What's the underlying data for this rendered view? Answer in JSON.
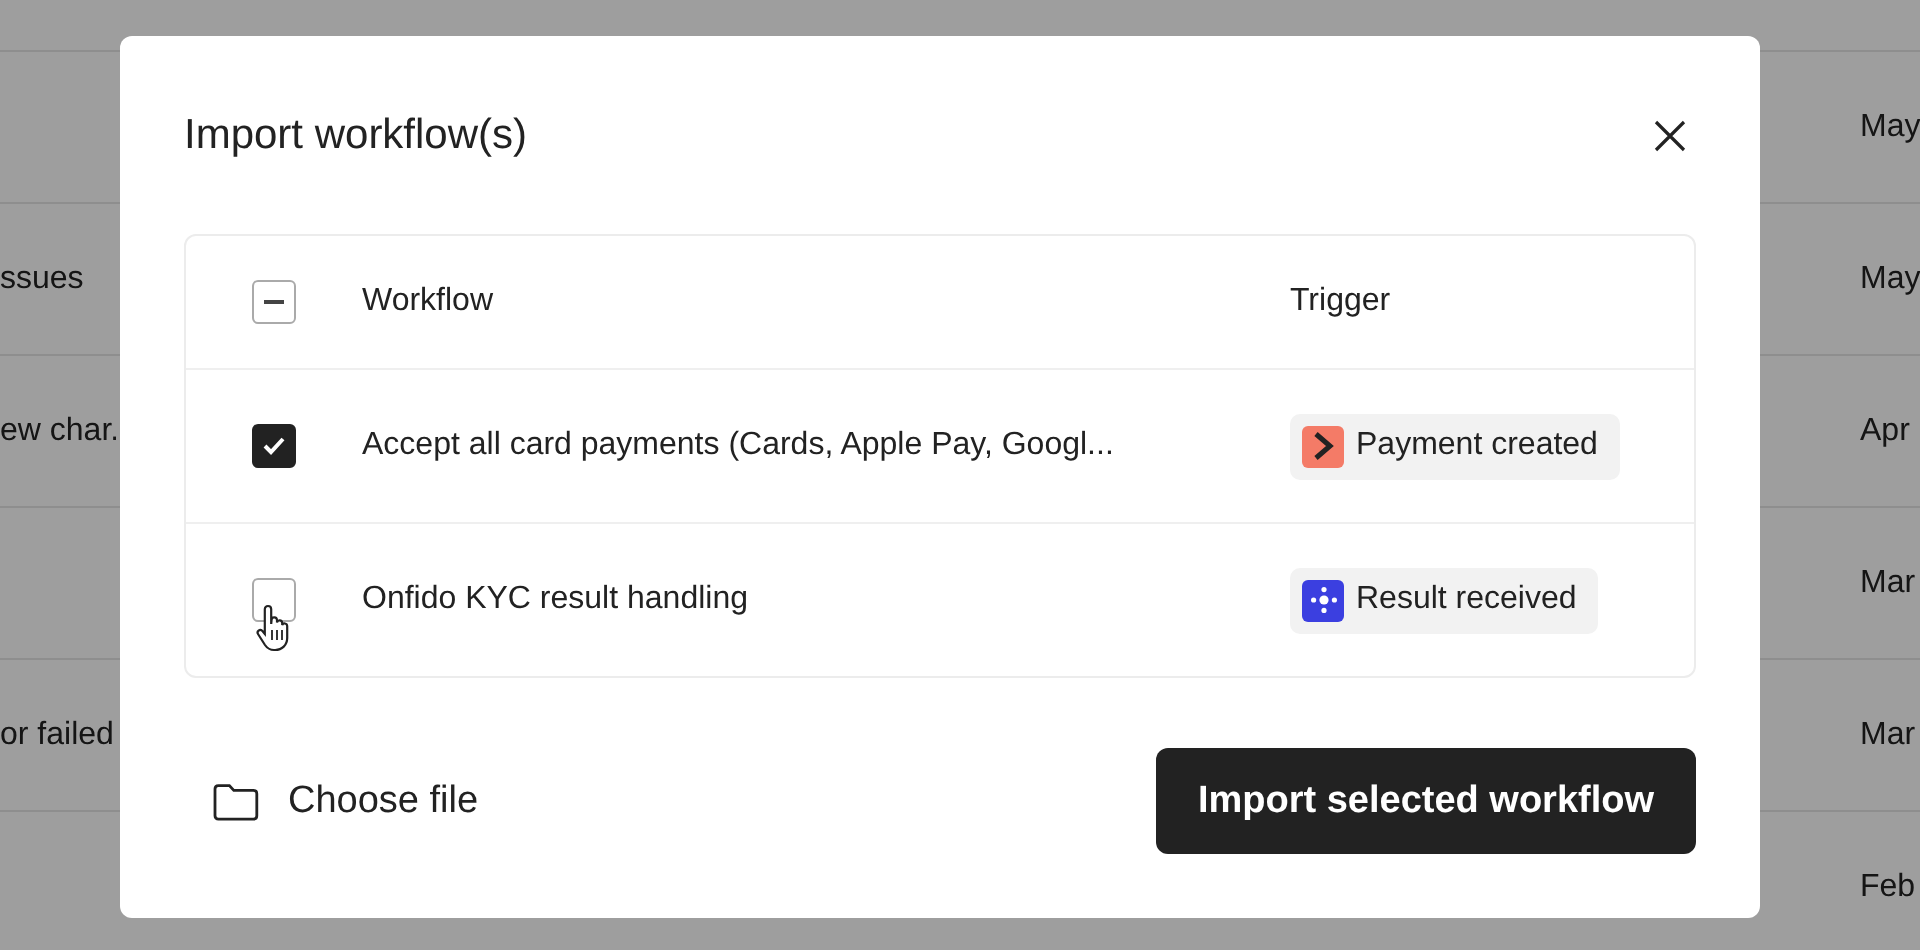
{
  "background_rows": [
    {
      "left": "",
      "right": "May"
    },
    {
      "left": "ssues",
      "right": "May"
    },
    {
      "left": "ew char.",
      "right": "Apr"
    },
    {
      "left": "",
      "right": "Mar"
    },
    {
      "left": "or failed",
      "right": "Mar"
    },
    {
      "left": "",
      "right": "Feb"
    }
  ],
  "dialog": {
    "title": "Import workflow(s)",
    "table": {
      "select_all": {
        "indeterminate": true
      },
      "columns": [
        "Workflow",
        "Trigger"
      ],
      "rows": [
        {
          "checked": true,
          "hovered": false,
          "workflow": "Accept all card payments (Cards, Apple Pay, Googl...",
          "trigger": "Payment created",
          "color": "#f47b67"
        },
        {
          "checked": false,
          "hovered": true,
          "workflow": "Onfido KYC result handling",
          "trigger": "Result received",
          "color": "#3b3fe0"
        }
      ]
    },
    "choose_file": "Choose file",
    "import_button": "Import selected workflow"
  }
}
